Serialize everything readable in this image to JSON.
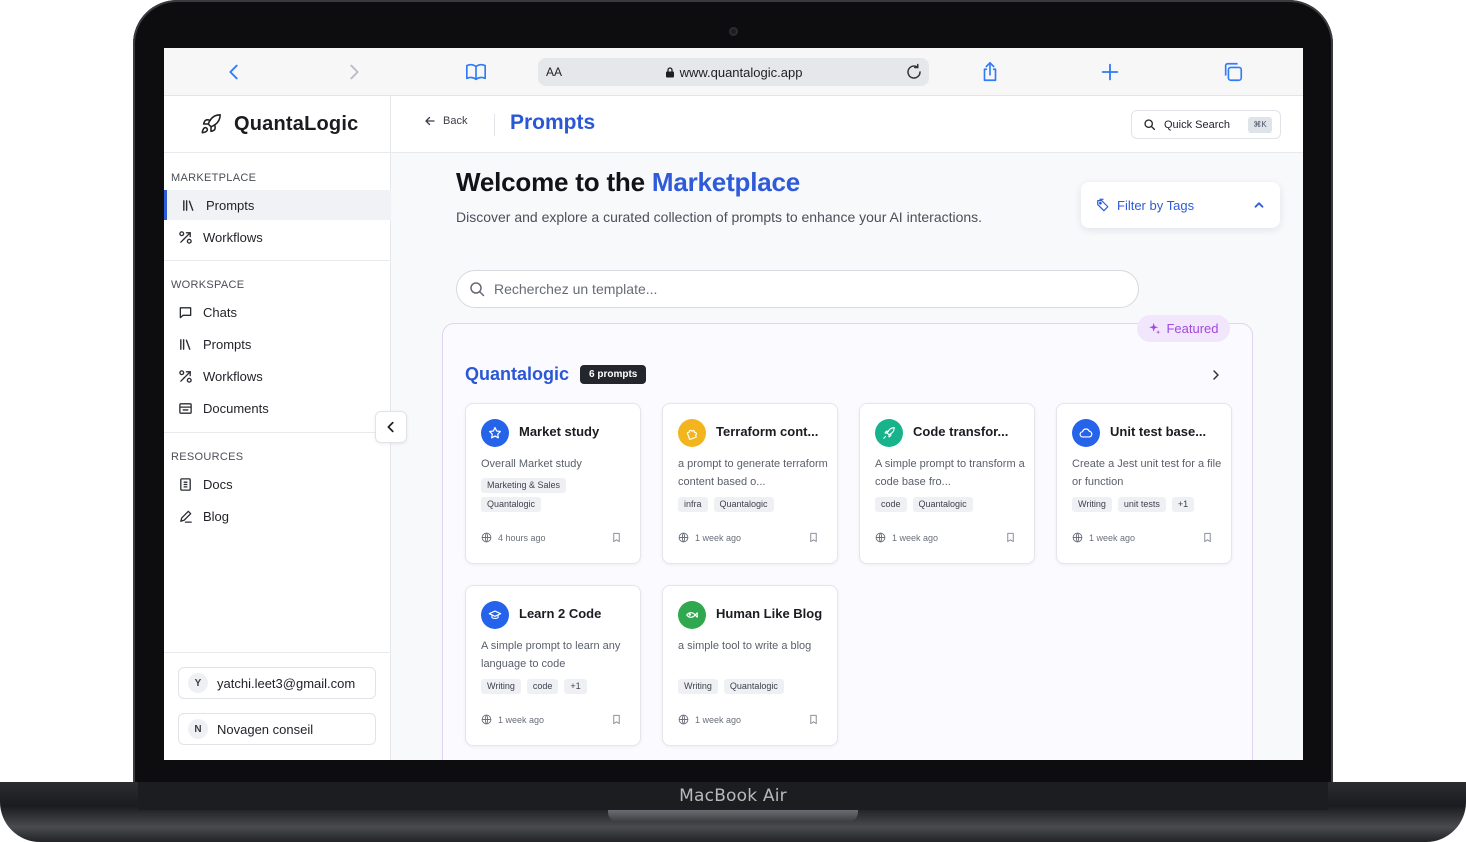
{
  "device": {
    "model_label": "MacBook Air"
  },
  "browser": {
    "aa_label": "AA",
    "url": "www.quantalogic.app"
  },
  "brand": {
    "name": "QuantaLogic"
  },
  "sidebar": {
    "sections": [
      {
        "title": "MARKETPLACE",
        "items": [
          {
            "label": "Prompts",
            "icon": "library-icon",
            "active": true
          },
          {
            "label": "Workflows",
            "icon": "workflow-icon"
          }
        ]
      },
      {
        "title": "WORKSPACE",
        "items": [
          {
            "label": "Chats",
            "icon": "chat-icon"
          },
          {
            "label": "Prompts",
            "icon": "library-icon"
          },
          {
            "label": "Workflows",
            "icon": "workflow-icon"
          },
          {
            "label": "Documents",
            "icon": "document-icon"
          }
        ]
      },
      {
        "title": "RESOURCES",
        "items": [
          {
            "label": "Docs",
            "icon": "docs-icon"
          },
          {
            "label": "Blog",
            "icon": "pen-icon"
          }
        ]
      }
    ],
    "accounts": [
      {
        "initial": "Y",
        "label": "yatchi.leet3@gmail.com"
      },
      {
        "initial": "N",
        "label": "Novagen conseil"
      }
    ]
  },
  "header": {
    "back_label": "Back",
    "title": "Prompts",
    "quick_search_label": "Quick Search",
    "quick_search_shortcut": "⌘K"
  },
  "main": {
    "welcome_prefix": "Welcome to the",
    "welcome_accent": "Marketplace",
    "subtitle": "Discover and explore a curated collection of prompts to enhance your AI interactions.",
    "filter_label": "Filter by Tags",
    "search_placeholder": "Recherchez un template...",
    "featured_label": "Featured",
    "collection": {
      "title": "Quantalogic",
      "count_label": "6 prompts",
      "cards": [
        {
          "title": "Market study",
          "description": "Overall Market study",
          "tags": [
            "Marketing & Sales",
            "Quantalogic"
          ],
          "time": "4 hours ago",
          "icon": "star-icon",
          "color": "#2563eb"
        },
        {
          "title": "Terraform cont...",
          "description": "a prompt to generate terraform content based o...",
          "tags": [
            "infra",
            "Quantalogic"
          ],
          "time": "1 week ago",
          "icon": "puzzle-icon",
          "color": "#f2b51d"
        },
        {
          "title": "Code transfor...",
          "description": "A simple prompt to transform a code base fro...",
          "tags": [
            "code",
            "Quantalogic"
          ],
          "time": "1 week ago",
          "icon": "rocket-icon",
          "color": "#17b38a"
        },
        {
          "title": "Unit test base...",
          "description": "Create a Jest unit test for a file or function",
          "tags": [
            "Writing",
            "unit tests",
            "+1"
          ],
          "time": "1 week ago",
          "icon": "cloud-icon",
          "color": "#2563eb"
        },
        {
          "title": "Learn 2 Code",
          "description": "A simple prompt to learn any language to code",
          "tags": [
            "Writing",
            "code",
            "+1"
          ],
          "time": "1 week ago",
          "icon": "graduation-cap-icon",
          "color": "#2563eb"
        },
        {
          "title": "Human Like Blog",
          "description": "a simple tool to write a blog",
          "tags": [
            "Writing",
            "Quantalogic"
          ],
          "time": "1 week ago",
          "icon": "fish-icon",
          "color": "#2fa84f"
        }
      ]
    }
  }
}
